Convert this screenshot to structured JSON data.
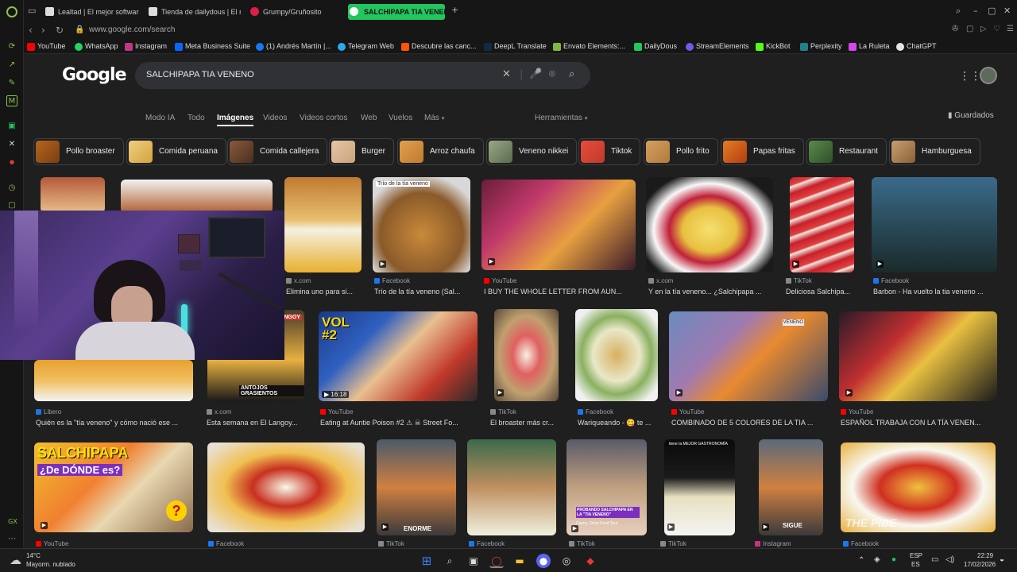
{
  "browser": {
    "tabs": [
      {
        "label": "Lealtad | El mejor software",
        "fav": "#eee"
      },
      {
        "label": "Tienda de dailydous | El m",
        "fav": "#ddd"
      },
      {
        "label": "Grumpy/Gruñosito",
        "fav": "#e11d48"
      },
      {
        "label": "SALCHIPAPA TIA VENENO",
        "fav": "#fff"
      }
    ],
    "new_tab": "+",
    "url": "www.google.com/search",
    "bookmarks": [
      {
        "label": "YouTube",
        "color": "#ff0000"
      },
      {
        "label": "WhatsApp",
        "color": "#25d366"
      },
      {
        "label": "Instagram",
        "color": "#c13584"
      },
      {
        "label": "Meta Business Suite",
        "color": "#0866ff"
      },
      {
        "label": "(1) Andrés Martín |...",
        "color": "#1877f2"
      },
      {
        "label": "Telegram Web",
        "color": "#2aabee"
      },
      {
        "label": "Descubre las canc...",
        "color": "#ff5500"
      },
      {
        "label": "DeepL Translate",
        "color": "#0f2b46"
      },
      {
        "label": "Envato Elements:...",
        "color": "#82b541"
      },
      {
        "label": "DailyDous",
        "color": "#22c55e"
      },
      {
        "label": "StreamElements",
        "color": "#6c5ce7"
      },
      {
        "label": "KickBot",
        "color": "#53fc18"
      },
      {
        "label": "Perplexity",
        "color": "#20808d"
      },
      {
        "label": "La Ruleta",
        "color": "#d946ef"
      },
      {
        "label": "ChatGPT",
        "color": "#e5e5e5"
      }
    ]
  },
  "google": {
    "logo": "Google",
    "query": "SALCHIPAPA TIA VENENO",
    "tabs": [
      "Modo IA",
      "Todo",
      "Imágenes",
      "Videos",
      "Videos cortos",
      "Web",
      "Vuelos",
      "Más"
    ],
    "active_tab": "Imágenes",
    "tools": "Herramientas",
    "saved": "Guardados",
    "chips": [
      {
        "label": "Pollo broaster",
        "color": "#b5651d"
      },
      {
        "label": "Comida peruana",
        "color": "#d4a23c"
      },
      {
        "label": "Comida callejera",
        "color": "#8a5a3c"
      },
      {
        "label": "Burger",
        "color": "#c9a37a"
      },
      {
        "label": "Arroz chaufa",
        "color": "#c27a2e"
      },
      {
        "label": "Veneno nikkei",
        "color": "#7a8a6a"
      },
      {
        "label": "Tiktok",
        "color": "#c0392b"
      },
      {
        "label": "Pollo frito",
        "color": "#b07b3c"
      },
      {
        "label": "Papas fritas",
        "color": "#d35400"
      },
      {
        "label": "Restaurant",
        "color": "#3b6b3a"
      },
      {
        "label": "Hamburguesa",
        "color": "#a97b4f"
      }
    ],
    "results_row1": [
      {
        "source": "x.com",
        "caption": "Elimina uno para si...",
        "src_color": "#888"
      },
      {
        "source": "Facebook",
        "caption": "Trío de la tía veneno (Sal...",
        "src_color": "#1877f2"
      },
      {
        "source": "YouTube",
        "caption": "I BUY THE WHOLE LETTER FROM AUN...",
        "src_color": "#ff0000"
      },
      {
        "source": "x.com",
        "caption": "Y en la tía veneno... ¿Salchipapa ...",
        "src_color": "#888"
      },
      {
        "source": "TikTok",
        "caption": "Deliciosa Salchipa...",
        "src_color": "#888"
      },
      {
        "source": "Facebook",
        "caption": "Barbon - Ha vuelto la tia veneno ...",
        "src_color": "#1877f2"
      }
    ],
    "results_row2": [
      {
        "source": "Libero",
        "caption": "Quién es la \"tía veneno\" y cómo nació ese ...",
        "src_color": "#1a73e8"
      },
      {
        "source": "x.com",
        "caption": "Esta semana en El Langoy...",
        "src_color": "#888"
      },
      {
        "source": "YouTube",
        "caption": "Eating at Auntie Poison #2 ⚠ ☠ Street Fo...",
        "src_color": "#ff0000"
      },
      {
        "source": "TikTok",
        "caption": "El broaster más cr...",
        "src_color": "#888"
      },
      {
        "source": "Facebook",
        "caption": "Wariqueando - 😋 te ...",
        "src_color": "#1877f2"
      },
      {
        "source": "YouTube",
        "caption": "COMBINADO DE 5 COLORES DE LA TIA ...",
        "src_color": "#ff0000"
      },
      {
        "source": "YouTube",
        "caption": "ESPAÑOL TRABAJA CON LA TÍA VENEN...",
        "src_color": "#ff0000"
      }
    ],
    "results_row3": [
      {
        "source": "YouTube",
        "src_color": "#ff0000"
      },
      {
        "source": "Facebook",
        "src_color": "#1877f2"
      },
      {
        "source": "TikTok",
        "src_color": "#888"
      },
      {
        "source": "Facebook",
        "src_color": "#1877f2"
      },
      {
        "source": "TikTok",
        "src_color": "#888"
      },
      {
        "source": "TikTok",
        "src_color": "#888"
      },
      {
        "source": "Instagram",
        "src_color": "#c13584"
      },
      {
        "source": "Facebook",
        "src_color": "#1877f2"
      }
    ],
    "overlays": {
      "dur_1618": "16:18",
      "vol2": "VOL #2",
      "antojos": "ANTOJOS GRASIENTOS",
      "salchipapa_title": "SALCHIPAPA",
      "donde": "¿De DÓNDE es?",
      "enorme": "ENORME",
      "sigue": "SIGUE",
      "probando": "PROBANDO SALCHIPAPA EN LA \"TIA VENENO\"",
      "probando_sub": "Cusco, Dríve Food Tour",
      "mejor_gastro": "tiene la MEJOR GASTRONOMÍA",
      "the_pibe": "THE PIBE",
      "trio_label": "Trío de la tía veneno",
      "vegan_sign": "VENENO",
      "langoy": "LANGOY"
    }
  },
  "taskbar": {
    "weather_temp": "14°C",
    "weather_desc": "Mayorm. nublado",
    "lang1": "ESP",
    "lang2": "ES",
    "time": "22:29",
    "date": "17/02/2026"
  },
  "sidebar_label": "GX"
}
